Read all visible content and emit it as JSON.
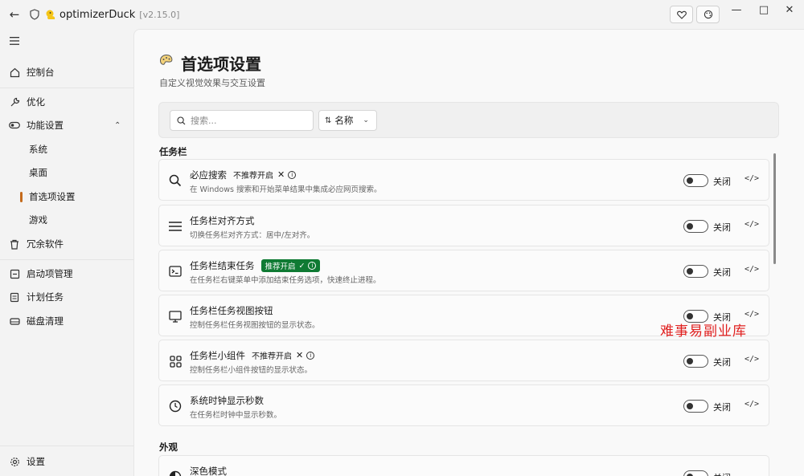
{
  "app": {
    "name": "optimizerDuck",
    "version": "[v2.15.0]"
  },
  "sidebar": {
    "items": [
      {
        "label": "控制台",
        "icon": "home-icon"
      },
      {
        "label": "优化",
        "icon": "wrench-icon"
      },
      {
        "label": "功能设置",
        "icon": "toggle-icon"
      },
      {
        "label": "系统"
      },
      {
        "label": "桌面"
      },
      {
        "label": "首选项设置"
      },
      {
        "label": "游戏"
      },
      {
        "label": "冗余软件",
        "icon": "trash-icon"
      },
      {
        "label": "启动项管理",
        "icon": "startup-icon"
      },
      {
        "label": "计划任务",
        "icon": "task-icon"
      },
      {
        "label": "磁盘清理",
        "icon": "disk-icon"
      }
    ],
    "settings_label": "设置"
  },
  "page": {
    "title": "首选项设置",
    "subtitle": "自定义视觉效果与交互设置"
  },
  "toolbar": {
    "search_placeholder": "搜索...",
    "sort_label": "名称"
  },
  "sections": {
    "taskbar": "任务栏",
    "appearance": "外观"
  },
  "cards": [
    {
      "title": "必应搜索",
      "tag": "不推荐开启",
      "tag_type": "no",
      "desc": "在 Windows 搜索和开始菜单结果中集成必应网页搜索。",
      "state": "关闭",
      "icon": "search-icon"
    },
    {
      "title": "任务栏对齐方式",
      "desc": "切换任务栏对齐方式：居中/左对齐。",
      "state": "关闭",
      "icon": "align-icon"
    },
    {
      "title": "任务栏结束任务",
      "tag": "推荐开启",
      "tag_type": "rec",
      "desc": "在任务栏右键菜单中添加结束任务选项，快速终止进程。",
      "state": "关闭",
      "icon": "terminal-icon"
    },
    {
      "title": "任务栏任务视图按钮",
      "desc": "控制任务栏任务视图按钮的显示状态。",
      "state": "关闭",
      "icon": "monitor-icon"
    },
    {
      "title": "任务栏小组件",
      "tag": "不推荐开启",
      "tag_type": "no",
      "desc": "控制任务栏小组件按钮的显示状态。",
      "state": "关闭",
      "icon": "widgets-icon"
    },
    {
      "title": "系统时钟显示秒数",
      "desc": "在任务栏时钟中显示秒数。",
      "state": "关闭",
      "icon": "clock-icon"
    },
    {
      "title": "深色模式",
      "state": "关闭",
      "icon": "contrast-icon"
    }
  ],
  "watermark": "难事易副业库"
}
